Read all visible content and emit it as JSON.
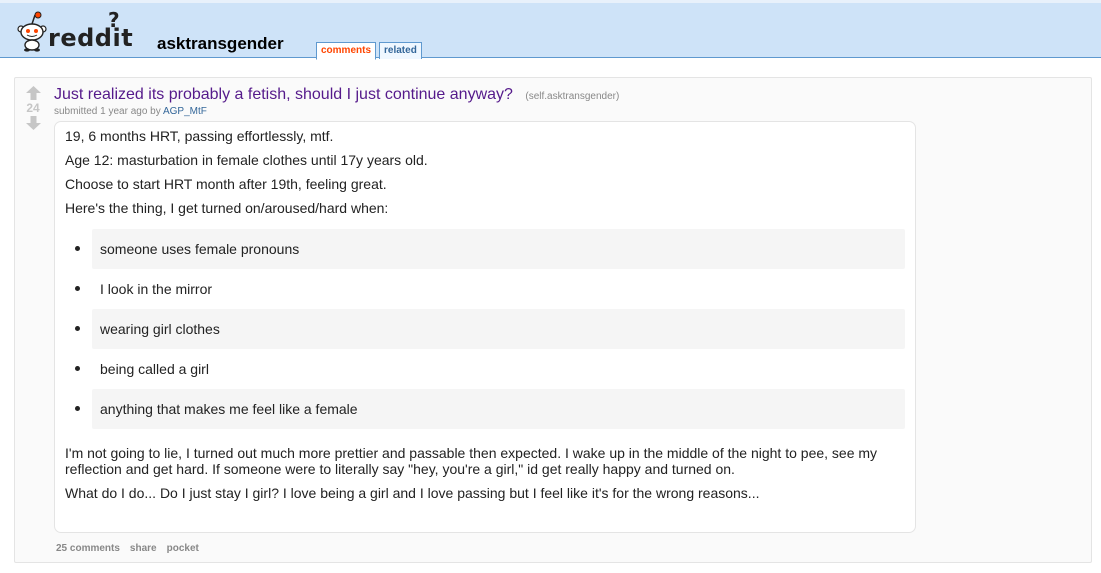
{
  "header": {
    "logo_text": "reddit",
    "logo_badge": "?",
    "subreddit": "asktransgender",
    "tabs": [
      {
        "label": "comments",
        "selected": true
      },
      {
        "label": "related",
        "selected": false
      }
    ]
  },
  "post": {
    "score": "24",
    "title": "Just realized its probably a fetish, should I just continue anyway?",
    "domain": "(self.asktransgender)",
    "tagline_prefix": "submitted 1 year ago by",
    "author": "AGP_MtF",
    "body": {
      "paragraphs_top": [
        "19, 6 months HRT, passing effortlessly, mtf.",
        "Age 12: masturbation in female clothes until 17y years old.",
        "Choose to start HRT month after 19th, feeling great.",
        "Here's the thing, I get turned on/aroused/hard when:"
      ],
      "bullets": [
        "someone uses female pronouns",
        "I look in the mirror",
        "wearing girl clothes",
        "being called a girl",
        "anything that makes me feel like a female"
      ],
      "paragraphs_bottom": [
        "I'm not going to lie, I turned out much more prettier and passable then expected. I wake up in the middle of the night to pee, see my reflection and get hard. If someone were to literally say \"hey, you're a girl,\" id get really happy and turned on.",
        "What do I do... Do I just stay I girl? I love being a girl and I love passing but I feel like it's for the wrong reasons..."
      ]
    },
    "buttons": {
      "comments": "25 comments",
      "share": "share",
      "pocket": "pocket"
    }
  },
  "colors": {
    "header_bg": "#cee3f8",
    "header_border": "#5f99cf",
    "title_visited": "#551a8b",
    "tab_selected": "#ff4500",
    "link": "#336699",
    "muted": "#888888"
  },
  "icons": {
    "logo": "reddit-alien-icon",
    "upvote": "upvote-arrow-icon",
    "downvote": "downvote-arrow-icon"
  }
}
